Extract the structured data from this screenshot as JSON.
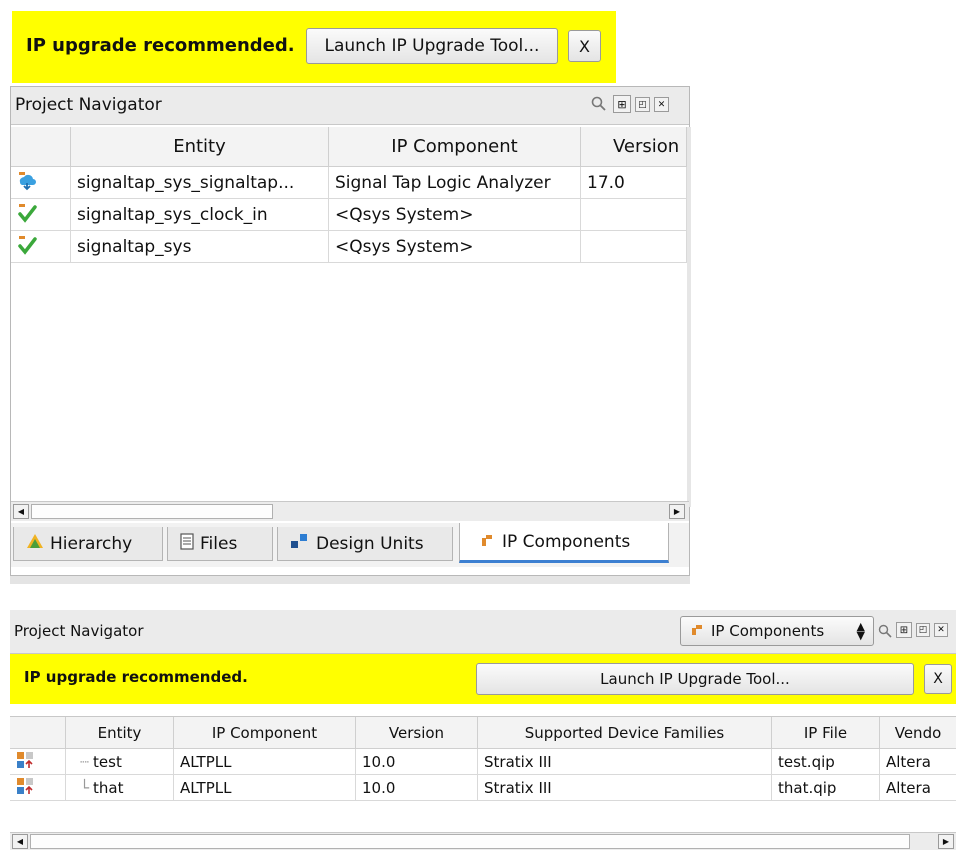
{
  "top": {
    "banner": {
      "message": "IP upgrade recommended.",
      "launch_label": "Launch IP Upgrade Tool...",
      "close_label": "X"
    },
    "navigator_title": "Project Navigator",
    "columns": [
      "Entity",
      "IP Component",
      "Version"
    ],
    "rows": [
      {
        "entity": "signaltap_sys_signaltap...",
        "component": "Signal Tap Logic Analyzer",
        "version": "17.0",
        "icon": "ip-upgrade-icon"
      },
      {
        "entity": "signaltap_sys_clock_in",
        "component": "<Qsys System>",
        "version": "",
        "icon": "ip-ok-icon"
      },
      {
        "entity": "signaltap_sys",
        "component": "<Qsys System>",
        "version": "",
        "icon": "ip-ok-icon"
      }
    ],
    "tabs": [
      {
        "label": "Hierarchy",
        "icon": "hierarchy-icon"
      },
      {
        "label": "Files",
        "icon": "files-icon"
      },
      {
        "label": "Design Units",
        "icon": "design-units-icon"
      },
      {
        "label": "IP Components",
        "icon": "ip-components-icon",
        "active": true
      }
    ]
  },
  "bottom": {
    "navigator_title": "Project Navigator",
    "view_selector": "IP Components",
    "banner": {
      "message": "IP upgrade recommended.",
      "launch_label": "Launch IP Upgrade Tool...",
      "close_label": "X"
    },
    "columns": [
      "Entity",
      "IP Component",
      "Version",
      "Supported Device Families",
      "IP File",
      "Vendo"
    ],
    "rows": [
      {
        "entity": "test",
        "component": "ALTPLL",
        "version": "10.0",
        "families": "Stratix III",
        "file": "test.qip",
        "vendor": "Altera"
      },
      {
        "entity": "that",
        "component": "ALTPLL",
        "version": "10.0",
        "families": "Stratix III",
        "file": "that.qip",
        "vendor": "Altera"
      }
    ]
  },
  "colors": {
    "banner": "#ffff00",
    "selected_tab_underline": "#3c7fd1"
  }
}
